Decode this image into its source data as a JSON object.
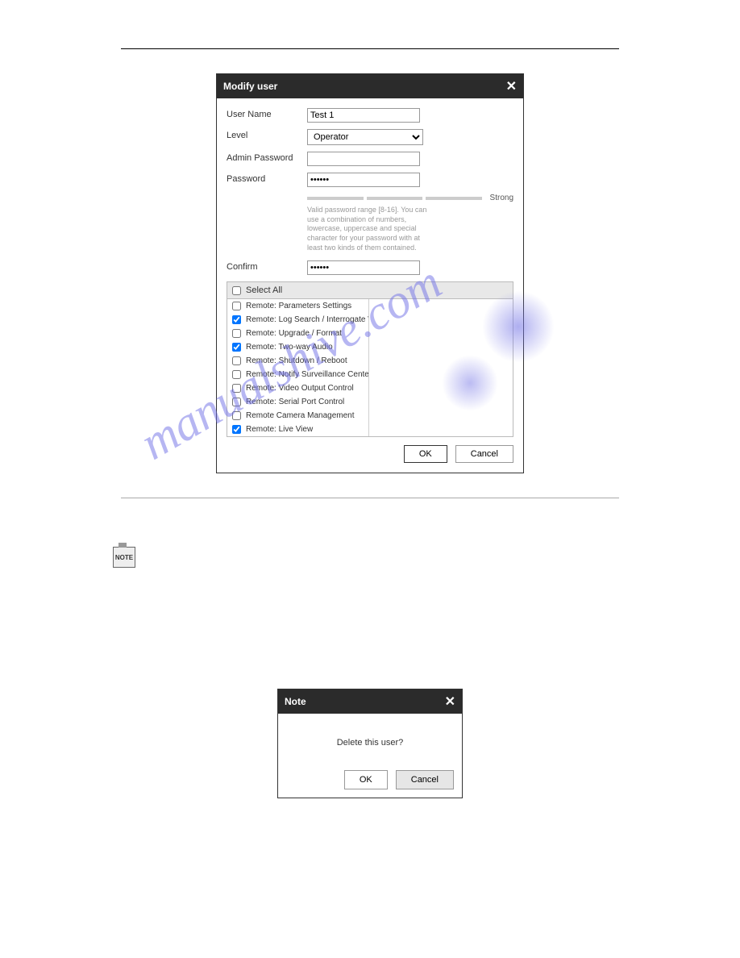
{
  "modifyDialog": {
    "title": "Modify user",
    "close": "✕",
    "userNameLabel": "User Name",
    "userNameValue": "Test 1",
    "levelLabel": "Level",
    "levelValue": "Operator",
    "adminPasswordLabel": "Admin Password",
    "adminPasswordValue": "",
    "passwordLabel": "Password",
    "passwordValue": "••••••",
    "strengthLabel": "Strong",
    "passwordHint": "Valid password range [8-16]. You can use a combination of numbers, lowercase, uppercase and special character for your password with at least two kinds of them contained.",
    "confirmLabel": "Confirm",
    "confirmValue": "••••••",
    "selectAllLabel": "Select All",
    "permissions": [
      {
        "label": "Remote: Parameters Settings",
        "checked": false
      },
      {
        "label": "Remote: Log Search / Interrogate Wor...",
        "checked": true
      },
      {
        "label": "Remote: Upgrade / Format",
        "checked": false
      },
      {
        "label": "Remote: Two-way Audio",
        "checked": true
      },
      {
        "label": "Remote: Shutdown / Reboot",
        "checked": false
      },
      {
        "label": "Remote: Notify Surveillance Center /...",
        "checked": false
      },
      {
        "label": "Remote: Video Output Control",
        "checked": false
      },
      {
        "label": "Remote: Serial Port Control",
        "checked": false
      },
      {
        "label": "Remote Camera Management",
        "checked": false
      },
      {
        "label": "Remote: Live View",
        "checked": true
      }
    ],
    "okLabel": "OK",
    "cancelLabel": "Cancel"
  },
  "noteDialog": {
    "title": "Note",
    "close": "✕",
    "message": "Delete this user?",
    "okLabel": "OK",
    "cancelLabel": "Cancel"
  },
  "noteIconText": "NOTE",
  "watermark": "manualshive.com"
}
